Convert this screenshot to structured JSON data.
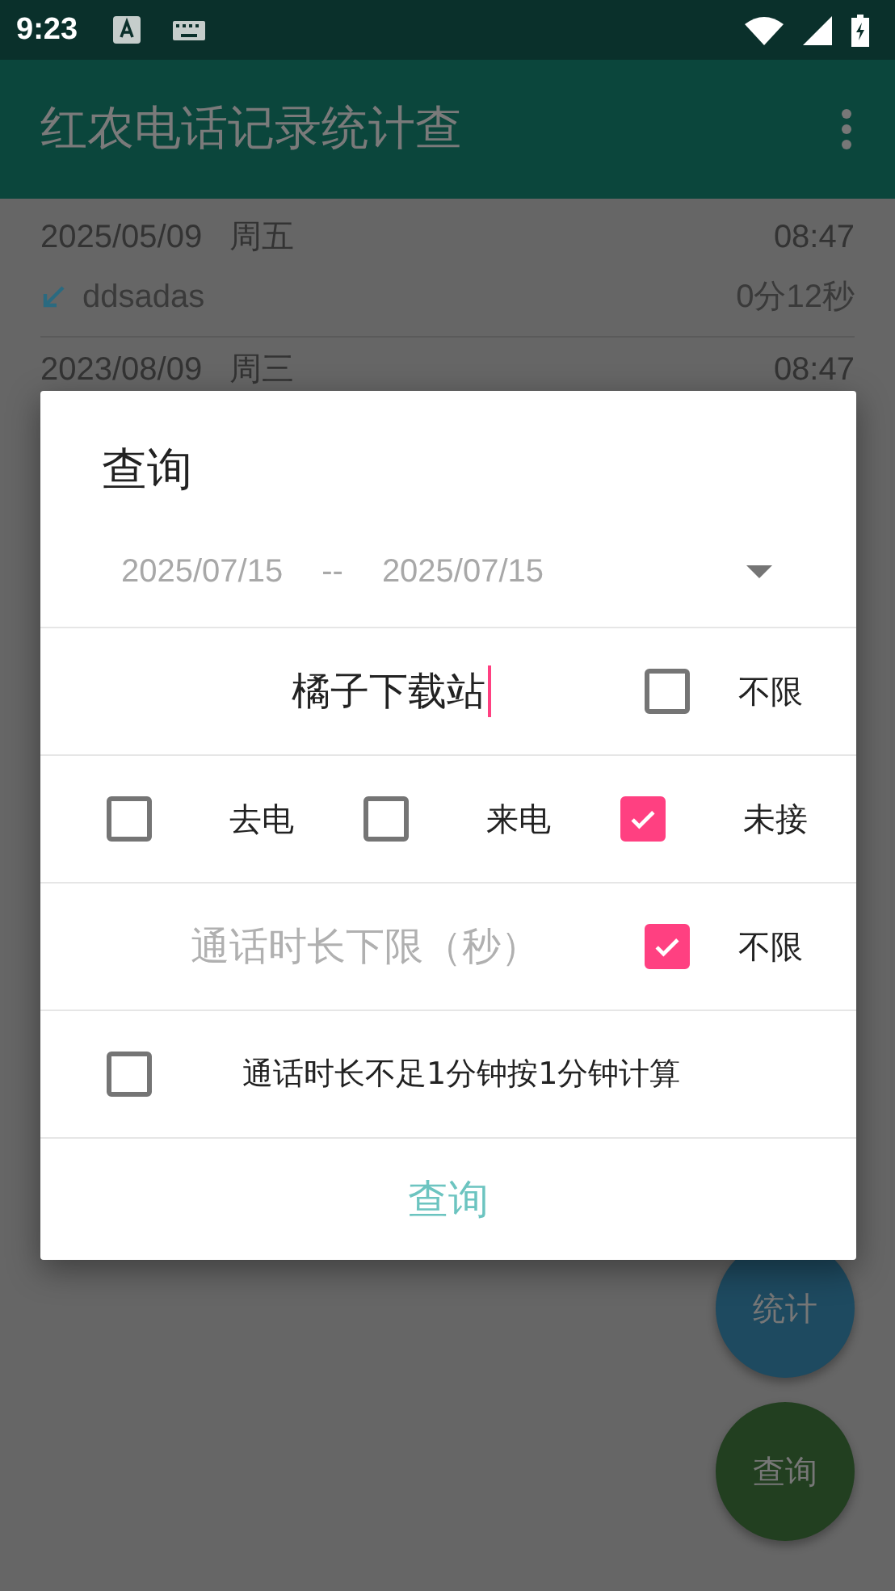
{
  "status_bar": {
    "time": "9:23"
  },
  "app_bar": {
    "title": "红农电话记录统计查"
  },
  "records": [
    {
      "date": "2025/05/09",
      "weekday": "周五",
      "time": "08:47",
      "name": "ddsadas",
      "duration": "0分12秒"
    },
    {
      "date": "2023/08/09",
      "weekday": "周三",
      "time": "08:47"
    }
  ],
  "fabs": [
    {
      "kind": "stats",
      "label": "统计"
    },
    {
      "kind": "query",
      "label": "查询"
    }
  ],
  "dialog": {
    "title": "查询",
    "date_from": "2025/07/15",
    "date_separator": "--",
    "date_to": "2025/07/15",
    "keyword": {
      "value": "橘子下载站"
    },
    "keyword_unlimited": {
      "label": "不限",
      "checked": false
    },
    "call_types": [
      {
        "label": "去电",
        "checked": false
      },
      {
        "label": "来电",
        "checked": false
      },
      {
        "label": "未接",
        "checked": true
      }
    ],
    "duration_min": {
      "placeholder": "通话时长下限（秒）"
    },
    "duration_unlimited": {
      "label": "不限",
      "checked": true
    },
    "round_up": {
      "label": "通话时长不足1分钟按1分钟计算",
      "checked": false
    },
    "button": "查询"
  }
}
